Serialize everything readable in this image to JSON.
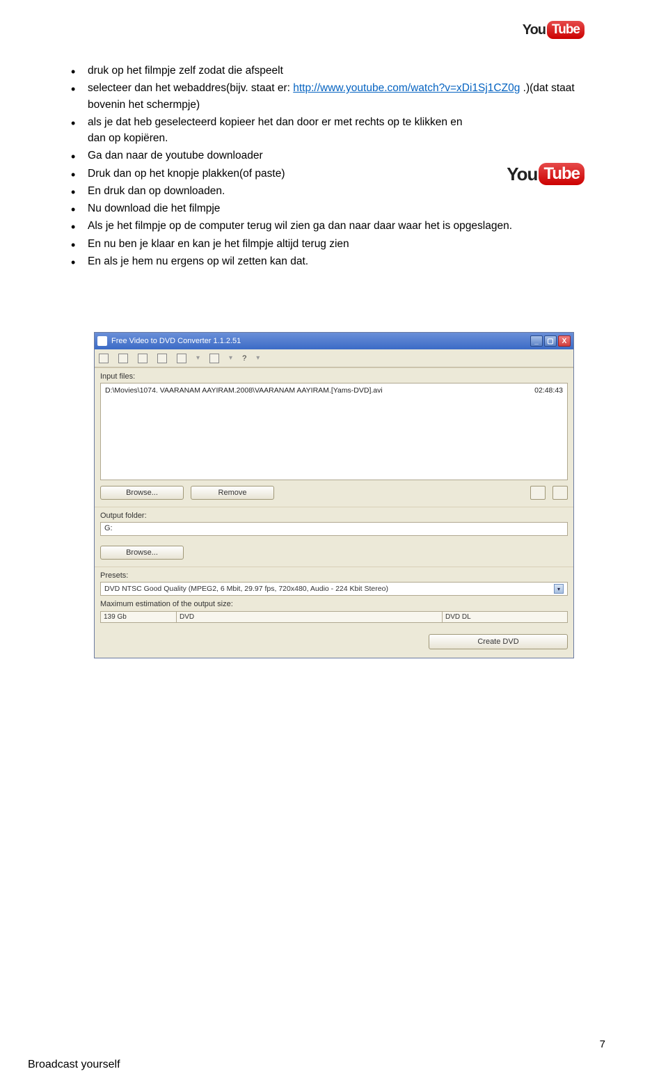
{
  "header_logo": {
    "you": "You",
    "tube": "Tube"
  },
  "inline_logo": {
    "you": "You",
    "tube": "Tube"
  },
  "bullets": {
    "b0a": "druk op het filmpje zelf zodat die afspeelt",
    "b1a": "selecteer dan het webaddres(bijv. staat er: ",
    "b1link": "http://www.youtube.com/watch?v=xDi1Sj1CZ0g",
    "b1b": " .)(dat staat bovenin het schermpje)",
    "b2": "als je dat heb geselecteerd kopieer het dan door er met rechts op te klikken en dan op kopiëren.",
    "b3": "Ga dan naar de youtube downloader",
    "b4": "Druk dan op het knopje plakken(of paste)",
    "b5": "En druk dan op downloaden.",
    "b6": "Nu download die het filmpje",
    "b7": "Als je het filmpje op de computer terug wil zien ga dan naar daar waar het is opgeslagen.",
    "b8": "En nu ben je klaar en kan je het filmpje altijd terug zien",
    "b9": "En als je hem nu ergens op wil zetten kan dat."
  },
  "app": {
    "title": "Free Video to DVD Converter 1.1.2.51",
    "min": "_",
    "max": "▢",
    "close": "X",
    "toolbar_q": "?",
    "input_files_label": "Input files:",
    "file_name": "D:\\Movies\\1074. VAARANAM AAYIRAM.2008\\VAARANAM AAYIRAM.[Yams-DVD].avi",
    "file_time": "02:48:43",
    "browse": "Browse...",
    "remove": "Remove",
    "output_folder_label": "Output folder:",
    "output_value": "G:",
    "presets_label": "Presets:",
    "preset_value": "DVD NTSC Good Quality (MPEG2, 6 Mbit, 29.97 fps, 720x480, Audio - 224 Kbit Stereo)",
    "dd": "▾",
    "max_est": "Maximum estimation of the output size:",
    "size1": "139 Gb",
    "size2": "DVD",
    "size3": "DVD DL",
    "create": "Create DVD"
  },
  "footer": "Broadcast yourself",
  "page_num": "7"
}
